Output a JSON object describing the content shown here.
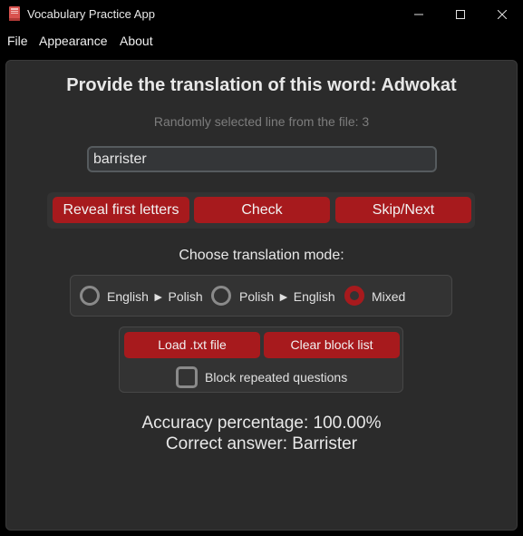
{
  "window": {
    "title": "Vocabulary Practice App",
    "icon": "book-icon",
    "controls": [
      "minimize-icon",
      "maximize-icon",
      "close-icon"
    ]
  },
  "menu": {
    "file": "File",
    "appearance": "Appearance",
    "about": "About"
  },
  "main": {
    "prompt_prefix": "Provide the translation of this word:",
    "prompt_word": "Adwokat",
    "line_info": "Randomly selected line from the file: 3",
    "answer_value": "barrister",
    "buttons": {
      "reveal": "Reveal first letters",
      "check": "Check",
      "skip": "Skip/Next"
    },
    "mode_label": "Choose translation mode:",
    "modes": [
      {
        "label": "English ► Polish",
        "selected": false
      },
      {
        "label": "Polish ► English",
        "selected": false
      },
      {
        "label": "Mixed",
        "selected": true
      }
    ],
    "file_controls": {
      "load": "Load .txt file",
      "clear": "Clear block list",
      "block_label": "Block repeated questions",
      "block_checked": false
    },
    "accuracy": "Accuracy percentage: 100.00%",
    "correct_answer": "Correct answer: Barrister"
  },
  "colors": {
    "accent": "#a71a1d",
    "background": "#2b2b2b",
    "frame": "#333333",
    "titlebar": "#000000"
  }
}
